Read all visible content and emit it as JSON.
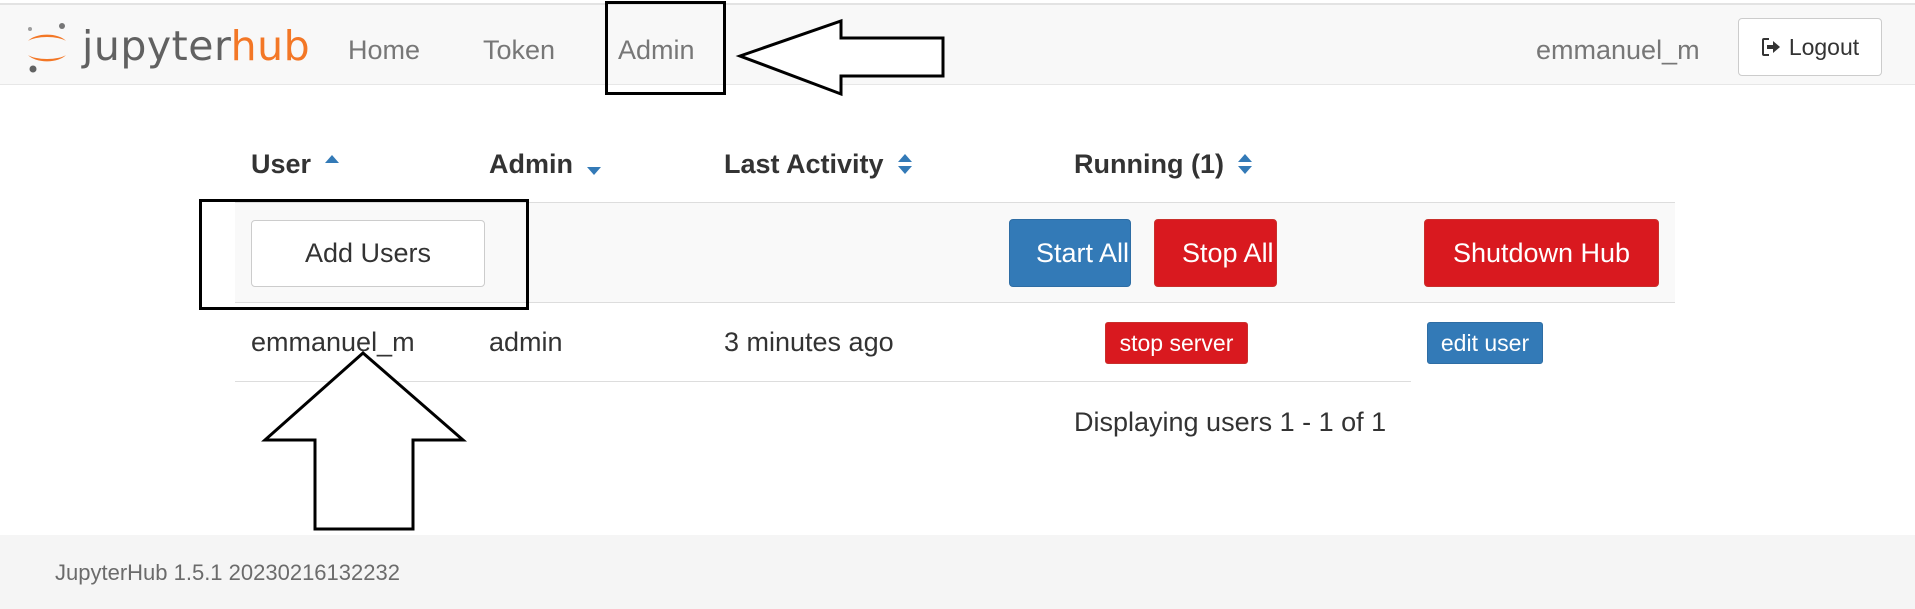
{
  "brand": {
    "name_part1": "jupyter",
    "name_part2": "hub",
    "colors": {
      "orange": "#f37726",
      "gray": "#616161"
    }
  },
  "nav": {
    "links": [
      {
        "label": "Home"
      },
      {
        "label": "Token"
      },
      {
        "label": "Admin"
      }
    ],
    "current_user": "emmanuel_m",
    "logout_label": "Logout",
    "logout_icon": "sign-out-icon"
  },
  "table": {
    "headers": {
      "user": "User",
      "admin": "Admin",
      "last_activity": "Last Activity",
      "running": "Running (1)"
    },
    "sort_icons": {
      "user": "sort-asc-icon",
      "admin": "sort-desc-icon",
      "last_activity": "sort-both-icon",
      "running": "sort-both-icon"
    },
    "actions": {
      "add_users": "Add Users",
      "start_all": "Start All",
      "stop_all": "Stop All",
      "shutdown_hub": "Shutdown Hub"
    },
    "rows": [
      {
        "name": "emmanuel_m",
        "admin": "admin",
        "last_activity": "3 minutes ago",
        "server_action": "stop server",
        "edit_label": "edit user"
      }
    ],
    "pagination": "Displaying users 1 - 1 of 1"
  },
  "footer": {
    "version_text": "JupyterHub 1.5.1 20230216132232"
  },
  "colors": {
    "primary": "#337ab7",
    "danger": "#d9191f",
    "annotation": "#000000"
  }
}
